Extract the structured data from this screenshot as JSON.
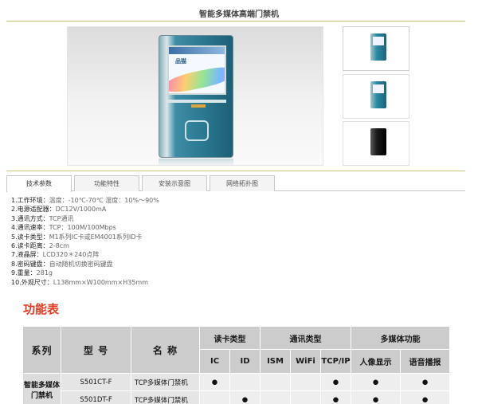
{
  "page": {
    "title": "智能多媒体高端门禁机"
  },
  "gallery": {
    "main_photo": {
      "screen_logo": "品猫"
    },
    "thumbnails": [
      {
        "style": "teal"
      },
      {
        "style": "teal"
      },
      {
        "style": "dark"
      }
    ]
  },
  "tabs": [
    {
      "label": "技术参数",
      "active": true
    },
    {
      "label": "功能特性",
      "active": false
    },
    {
      "label": "安装示意图",
      "active": false
    },
    {
      "label": "网络拓扑图",
      "active": false
    }
  ],
  "specs": [
    {
      "key": "1.工作环境：",
      "value": "温度：-10℃-70℃ 湿度：10%～90%"
    },
    {
      "key": "2.电源适配器：",
      "value": "DC12V/1000mA"
    },
    {
      "key": "3.通讯方式：",
      "value": "TCP通讯"
    },
    {
      "key": "4.通讯速率：",
      "value": "TCP：100M/100Mbps"
    },
    {
      "key": "5.读卡类型：",
      "value": "M1系列IC卡或EM4001系列ID卡"
    },
    {
      "key": "6.读卡距离：",
      "value": "2-8cm"
    },
    {
      "key": "7.液晶屏：",
      "value": "LCD320＊240点阵"
    },
    {
      "key": "8.密码键盘：",
      "value": "自动随机切换密码键盘"
    },
    {
      "key": "9.重量：",
      "value": "281g"
    },
    {
      "key": "10.外观尺寸：",
      "value": "L138mm×W100mm×H35mm"
    }
  ],
  "function_table": {
    "title": "功能表",
    "headers": {
      "series": "系列",
      "model": "型  号",
      "name": "名  称",
      "card_group": "读卡类型",
      "comm_group": "通讯类型",
      "media_group": "多媒体功能",
      "sub": [
        "IC",
        "ID",
        "ISM",
        "WiFi",
        "TCP/IP",
        "人像显示",
        "语音播报"
      ]
    },
    "series_name": "智能多媒体门禁机",
    "rows": [
      {
        "model": "S501CT-F",
        "name": "TCP多媒体门禁机",
        "marks": [
          "●",
          "",
          "",
          "",
          "●",
          "●",
          "●"
        ]
      },
      {
        "model": "S501DT-F",
        "name": "TCP多媒体门禁机",
        "marks": [
          "",
          "●",
          "",
          "",
          "●",
          "●",
          "●"
        ]
      }
    ]
  },
  "colors": {
    "rule": "#c9c27c",
    "func_title": "#e53a21",
    "table_header": "#cccccc"
  }
}
